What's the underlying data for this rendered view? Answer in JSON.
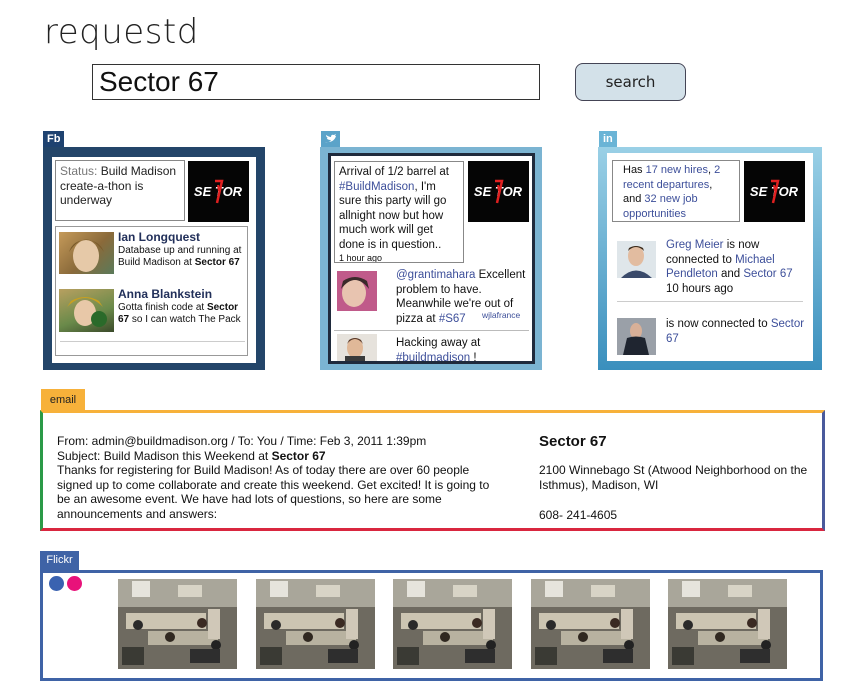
{
  "app": {
    "logo": "requestd"
  },
  "search": {
    "query": "Sector 67",
    "button_label": "search"
  },
  "facebook": {
    "tab_label": "Fb",
    "status_label": "Status:",
    "status_text": "Build Madison create-a-thon is underway",
    "posts": [
      {
        "name": "Ian Longquest",
        "text": "Database up and running at Build Madison at",
        "bold": "Sector 67"
      },
      {
        "name": "Anna Blankstein",
        "text_before": "Gotta finish code at",
        "bold": "Sector 67",
        "text_after": "so I can watch The Pack"
      }
    ]
  },
  "twitter": {
    "tweet_main": {
      "before": "Arrival of 1/2 barrel at",
      "tag": "#BuildMadison",
      "after": ", I'm sure this party will go allnight now but how much work will get done is in question..",
      "time": "1 hour ago"
    },
    "tweet_2": {
      "handle": "@grantimahara",
      "text": "Excellent problem to have. Meanwhile we're out of pizza at",
      "tag": "#S67",
      "by": "wjlafrance"
    },
    "tweet_3": {
      "text": "Hacking away at",
      "tag": "#buildmadison",
      "after": "!"
    }
  },
  "linkedin": {
    "tab_label": "in",
    "summary": {
      "before": "Has",
      "hires": "17 new hires",
      "sep1": ",",
      "departures": "2 recent departures",
      "sep2": ", and",
      "jobs": "32 new job opportunities"
    },
    "updates": [
      {
        "name": "Greg Meier",
        "mid": "is now connected to",
        "target": "Michael Pendleton",
        "and": "and",
        "target2": "Sector 67",
        "time": "10 hours ago"
      },
      {
        "mid": "is now connected to",
        "target": "Sector 67"
      }
    ]
  },
  "email": {
    "tab_label": "email",
    "from_line": "From: admin@buildmadison.org  / To: You / Time: Feb 3, 2011 1:39pm",
    "subject_prefix": "Subject: Build Madison this Weekend at",
    "subject_bold": "Sector 67",
    "body": "Thanks for registering for Build Madison!  As of today there are over 60 people signed up to come collaborate and create this weekend. Get excited! It is going to be an awesome event. We have had lots of questions, so here are some announcements and answers:",
    "contact_name": "Sector 67",
    "address": "2100 Winnebago St (Atwood Neighborhood on the Isthmus), Madison, WI",
    "phone": "608- 241-4605"
  },
  "flickr": {
    "tab_label": "Flickr"
  },
  "logo_text": "SECTOR 67",
  "colors": {
    "facebook": "#234569",
    "twitter": "#7bb4d2",
    "linkedin": "#3a8fbd",
    "email_top": "#f7b13a",
    "flickr": "#3f63a6",
    "link": "#3d4f9a"
  }
}
